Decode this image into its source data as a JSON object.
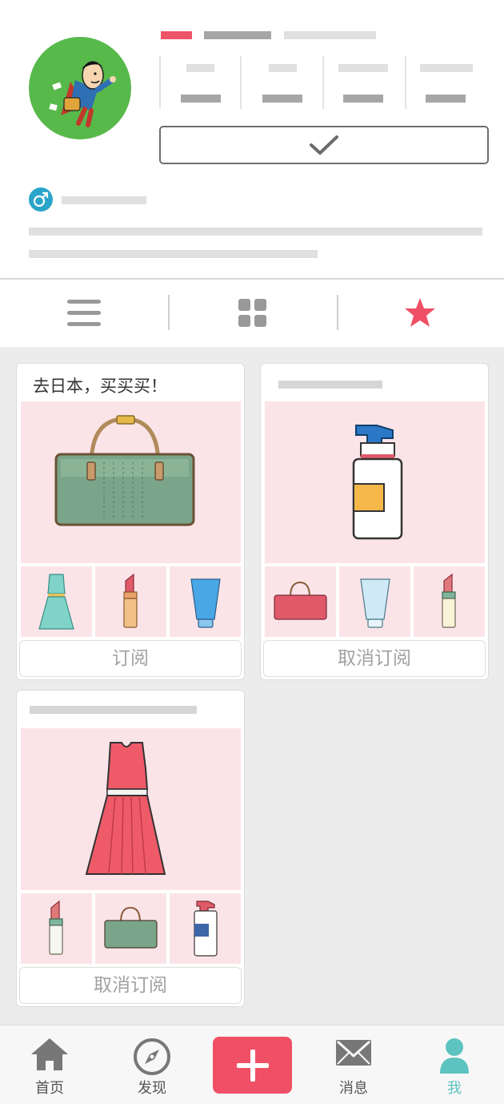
{
  "colors": {
    "accent": "#ef5066",
    "active_tab": "#5cc3c0",
    "avatar_bg": "#58b94b",
    "gender_badge": "#2aa5c9",
    "card_image_bg": "#fbe4e8",
    "page_bg": "#ececec"
  },
  "profile": {
    "avatar_icon": "superhero-avatar",
    "follow_icon": "checkmark-icon",
    "gender_icon": "male-icon"
  },
  "view_switch": {
    "items": [
      {
        "icon": "list-icon"
      },
      {
        "icon": "grid-icon"
      },
      {
        "icon": "star-icon",
        "active": true
      }
    ]
  },
  "collections": [
    {
      "title": "去日本，买买买！",
      "hero_icon": "handbag-icon",
      "thumbs": [
        "dress-icon",
        "lipstick-icon",
        "tube-icon"
      ],
      "button": "订阅"
    },
    {
      "title": "",
      "hero_icon": "pump-bottle-icon",
      "thumbs": [
        "handbag-icon",
        "tube-icon",
        "lipstick-icon"
      ],
      "button": "取消订阅"
    },
    {
      "title": "",
      "hero_icon": "dress-icon",
      "thumbs": [
        "lipstick-icon",
        "handbag-icon",
        "pump-bottle-icon"
      ],
      "button": "取消订阅"
    }
  ],
  "tabbar": {
    "home": "首页",
    "discover": "发现",
    "messages": "消息",
    "me": "我"
  }
}
